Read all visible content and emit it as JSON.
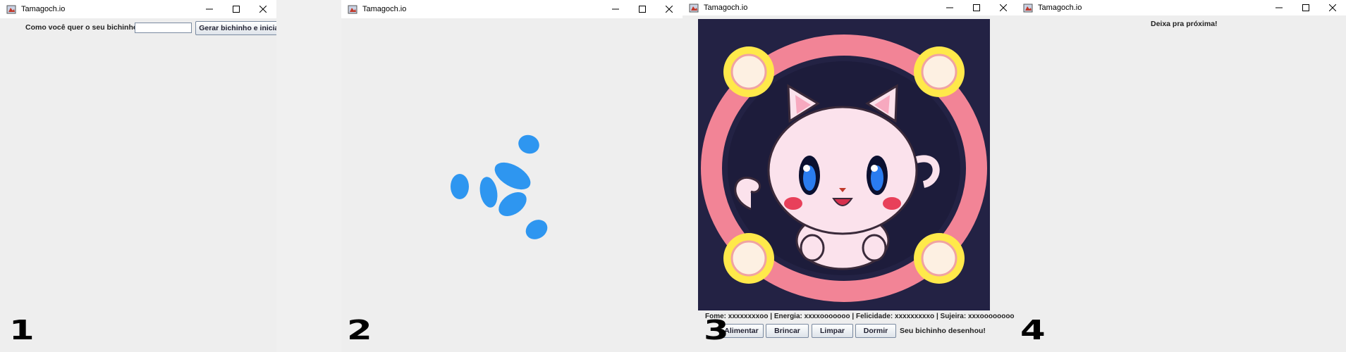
{
  "windows": [
    {
      "title": "Tamagoch.io",
      "prompt_label": "Como você quer o seu bichinho?",
      "name_input": {
        "value": "",
        "placeholder": ""
      },
      "generate_button": "Gerar bichinho e iniciar o jogo.",
      "step": "1"
    },
    {
      "title": "Tamagoch.io",
      "loading_indicator": "spinner",
      "step": "2"
    },
    {
      "title": "Tamagoch.io",
      "pet_image": "pink-kitten-illustration",
      "status_line": "Fome: xxxxxxxxoo | Energia: xxxxooooooo | Felicidade: xxxxxxxxxo | Sujeira: xxxoooooooo",
      "buttons": [
        "Alimentar",
        "Brincar",
        "Limpar",
        "Dormir"
      ],
      "message": "Seu bichinho desenhou!",
      "step": "3"
    },
    {
      "title": "Tamagoch.io",
      "message": "Deixa pra próxima!",
      "step": "4"
    }
  ],
  "icons": {
    "app": "tamagochio-app-icon",
    "minimize": "minimize-icon",
    "maximize": "maximize-icon",
    "close": "close-icon"
  },
  "colors": {
    "spinner": "#2e96f0",
    "pet_background": "#232244",
    "ring": "#f28496",
    "lamp_outer": "#ffe94a",
    "lamp_inner": "#fdf0e2"
  }
}
